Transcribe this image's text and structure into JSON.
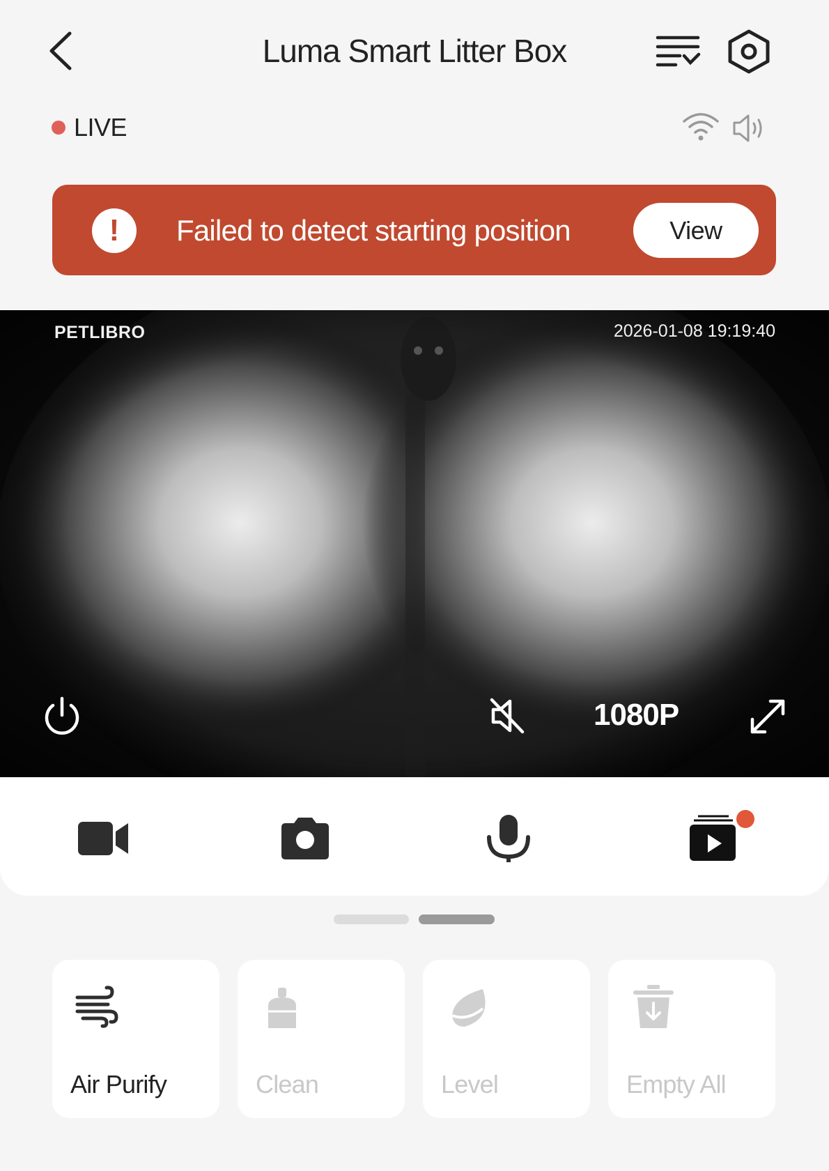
{
  "header": {
    "title": "Luma Smart Litter Box",
    "back_icon": "chevron-left-icon",
    "list_icon": "list-check-icon",
    "settings_icon": "hex-settings-icon"
  },
  "status": {
    "live_label": "LIVE",
    "live_color": "#e06058",
    "wifi_icon": "wifi-icon",
    "speaker_icon": "speaker-icon"
  },
  "alert": {
    "icon_text": "!",
    "message": "Failed to detect starting position",
    "button_label": "View",
    "background": "#c0492f"
  },
  "video": {
    "brand": "PETLIBRO",
    "timestamp": "2026-01-08 19:19:40",
    "resolution": "1080P",
    "power_icon": "power-icon",
    "mute_icon": "mute-icon",
    "fullscreen_icon": "fullscreen-icon"
  },
  "controls": {
    "items": [
      {
        "icon": "video-record-icon"
      },
      {
        "icon": "camera-snapshot-icon"
      },
      {
        "icon": "microphone-icon"
      },
      {
        "icon": "playback-icon",
        "badge": true
      }
    ],
    "badge_color": "#e0573a"
  },
  "pager": {
    "pages": 2,
    "active": 2
  },
  "actions": [
    {
      "label": "Air Purify",
      "icon": "wind-icon",
      "enabled": true
    },
    {
      "label": "Clean",
      "icon": "brush-icon",
      "enabled": false
    },
    {
      "label": "Level",
      "icon": "level-icon",
      "enabled": false
    },
    {
      "label": "Empty All",
      "icon": "trash-icon",
      "enabled": false
    }
  ]
}
